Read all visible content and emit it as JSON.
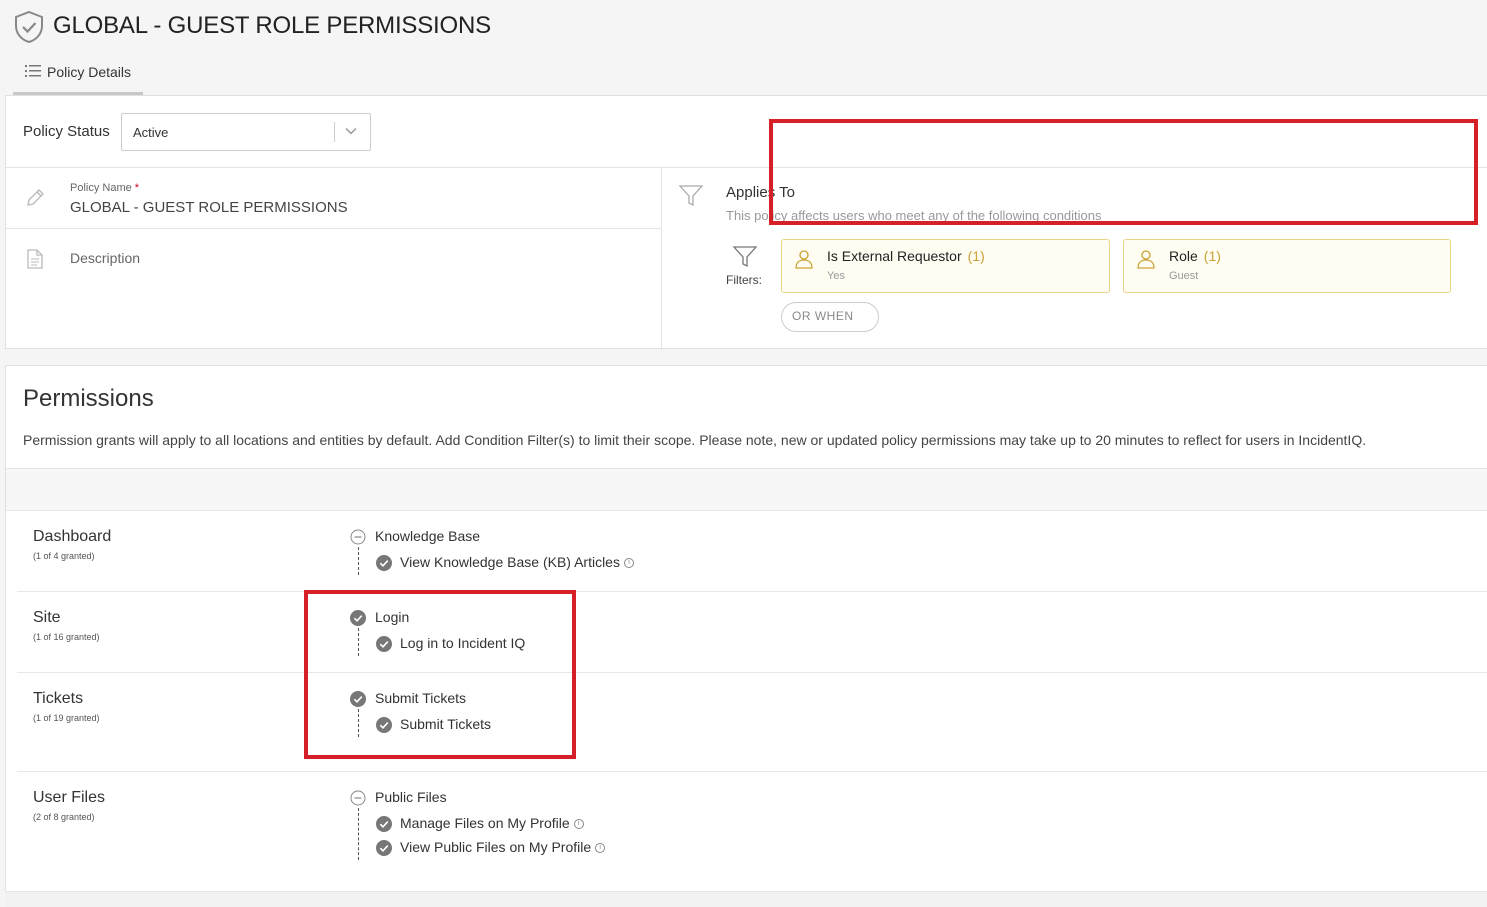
{
  "header": {
    "title": "GLOBAL - GUEST ROLE PERMISSIONS",
    "tab_label": "Policy Details"
  },
  "policy": {
    "status_label": "Policy Status",
    "status_value": "Active",
    "name_label": "Policy Name",
    "name_required": "*",
    "name_value": "GLOBAL - GUEST ROLE PERMISSIONS",
    "description_label": "Description"
  },
  "applies_to": {
    "title": "Applies To",
    "subtitle": "This policy affects users who meet any of the following conditions",
    "filters_label": "Filters:",
    "filters": [
      {
        "title": "Is External Requestor",
        "count": "(1)",
        "value": "Yes"
      },
      {
        "title": "Role",
        "count": "(1)",
        "value": "Guest"
      }
    ],
    "or_when_label": "OR WHEN"
  },
  "permissions": {
    "title": "Permissions",
    "description": "Permission grants will apply to all locations and entities by default. Add Condition Filter(s) to limit their scope. Please note, new or updated policy permissions may take up to 20 minutes to reflect for users in IncidentIQ.",
    "categories": [
      {
        "name": "Dashboard",
        "granted": "(1 of 4 granted)",
        "group": "Knowledge Base",
        "items": [
          "View Knowledge Base (KB) Articles"
        ]
      },
      {
        "name": "Site",
        "granted": "(1 of 16 granted)",
        "group": "Login",
        "items": [
          "Log in to Incident IQ"
        ]
      },
      {
        "name": "Tickets",
        "granted": "(1 of 19 granted)",
        "group": "Submit Tickets",
        "items": [
          "Submit Tickets"
        ]
      },
      {
        "name": "User Files",
        "granted": "(2 of 8 granted)",
        "group": "Public Files",
        "items": [
          "Manage Files on My Profile",
          "View Public Files on My Profile"
        ]
      }
    ]
  },
  "colors": {
    "highlight_box": "#d61f26",
    "chip_border": "#e6d58a",
    "chip_count": "#c9a236",
    "check_fill": "#777777"
  },
  "icons": [
    "shield-icon",
    "list-icon",
    "chevron-down-icon",
    "pencil-icon",
    "document-icon",
    "funnel-icon",
    "person-icon",
    "check-circle-icon",
    "minus-circle-icon",
    "info-icon"
  ]
}
